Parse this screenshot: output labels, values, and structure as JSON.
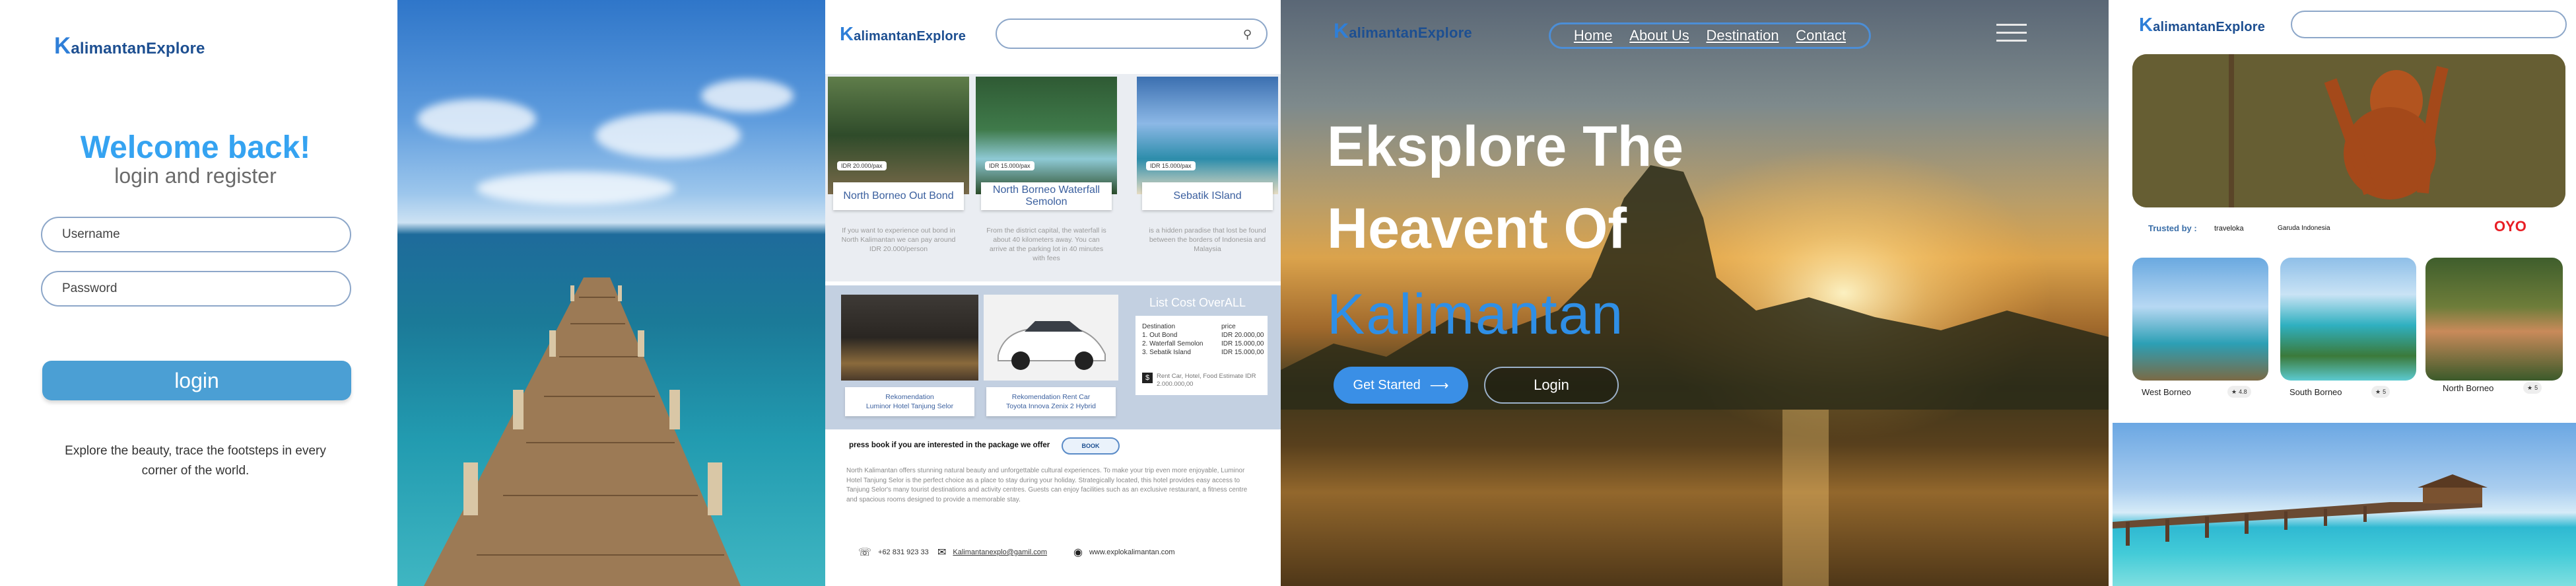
{
  "brand": {
    "k": "K",
    "rest": "alimantanExplore"
  },
  "login": {
    "welcome": "Welcome back!",
    "subtitle": "login and register",
    "username_placeholder": "Username",
    "password_placeholder": "Password",
    "login_button": "login",
    "tagline": "Explore the beauty, trace the footsteps in every corner of the world."
  },
  "tours": {
    "cards": [
      {
        "price": "IDR 20.000/pax",
        "title": "North Borneo Out Bond",
        "desc": "If you want to experience out bond in North Kalimantan we can pay around IDR 20.000/person"
      },
      {
        "price": "IDR 15.000/pax",
        "title": "North Borneo Waterfall Semolon",
        "desc": "From the district capital, the waterfall is about 40 kilometers away. You can arrive at the parking lot in 40 minutes with fees"
      },
      {
        "price": "IDR 15.000/pax",
        "title": "Sebatik ISland",
        "desc": "is a hidden paradise that lost be found between the borders of Indonesia and Malaysia"
      }
    ],
    "rec_hotel": {
      "line1": "Rekomendation",
      "line2": "Luminor Hotel Tanjung Selor"
    },
    "rec_car": {
      "line1": "Rekomendation Rent Car",
      "line2": "Toyota Innova Zenix 2 Hybrid"
    },
    "cost": {
      "title": "List Cost OverALL",
      "dest_head": "Destination",
      "price_head": "price",
      "rows": [
        {
          "name": "1. Out Bond",
          "price": "IDR 20.000,00"
        },
        {
          "name": "2. Waterfall Semolon",
          "price": "IDR 15.000,00"
        },
        {
          "name": "3. Sebatik Island",
          "price": "IDR 15.000,00"
        }
      ],
      "note": "Rent Car, Hotel, Food Estimate IDR 2.000.000,00"
    },
    "press": "press book if you are interested in the package we offer",
    "book": "BOOK",
    "paragraph": "North Kalimantan offers stunning natural beauty and unforgettable cultural experiences. To make your trip even more enjoyable, Luminor Hotel Tanjung Selor is the perfect choice as a place to stay during your holiday. Strategically located, this hotel provides easy access to Tanjung Selor's many tourist destinations and activity centres. Guests can enjoy facilities such as an exclusive restaurant, a fitness centre and spacious rooms designed to provide a memorable stay.",
    "phone": "+62 831 923 33",
    "email": "Kalimantanexplo@gamil.com",
    "web": "www.explokalimantan.com"
  },
  "hero": {
    "nav": [
      "Home",
      "About Us",
      "Destination",
      "Contact"
    ],
    "line1": "Eksplore The",
    "line2": "Heavent Of",
    "line3": "Kalimantan",
    "get_started": "Get Started",
    "login": "Login"
  },
  "dest": {
    "trusted": "Trusted by :",
    "partners": [
      "traveloka",
      "Garuda Indonesia",
      "OYO"
    ],
    "items": [
      {
        "name": "West Borneo",
        "rating": "4.8"
      },
      {
        "name": "South Borneo",
        "rating": "5"
      },
      {
        "name": "North Borneo",
        "rating": "5"
      }
    ]
  },
  "colors": {
    "brand_blue": "#2f7fd8",
    "accent": "#35a3f1",
    "button": "#4b9fd4",
    "oyo_red": "#e81e25"
  },
  "icons": [
    "search-icon",
    "arrow-right-icon",
    "hamburger-menu-icon",
    "phone-icon",
    "mail-icon",
    "globe-icon",
    "star-icon"
  ]
}
